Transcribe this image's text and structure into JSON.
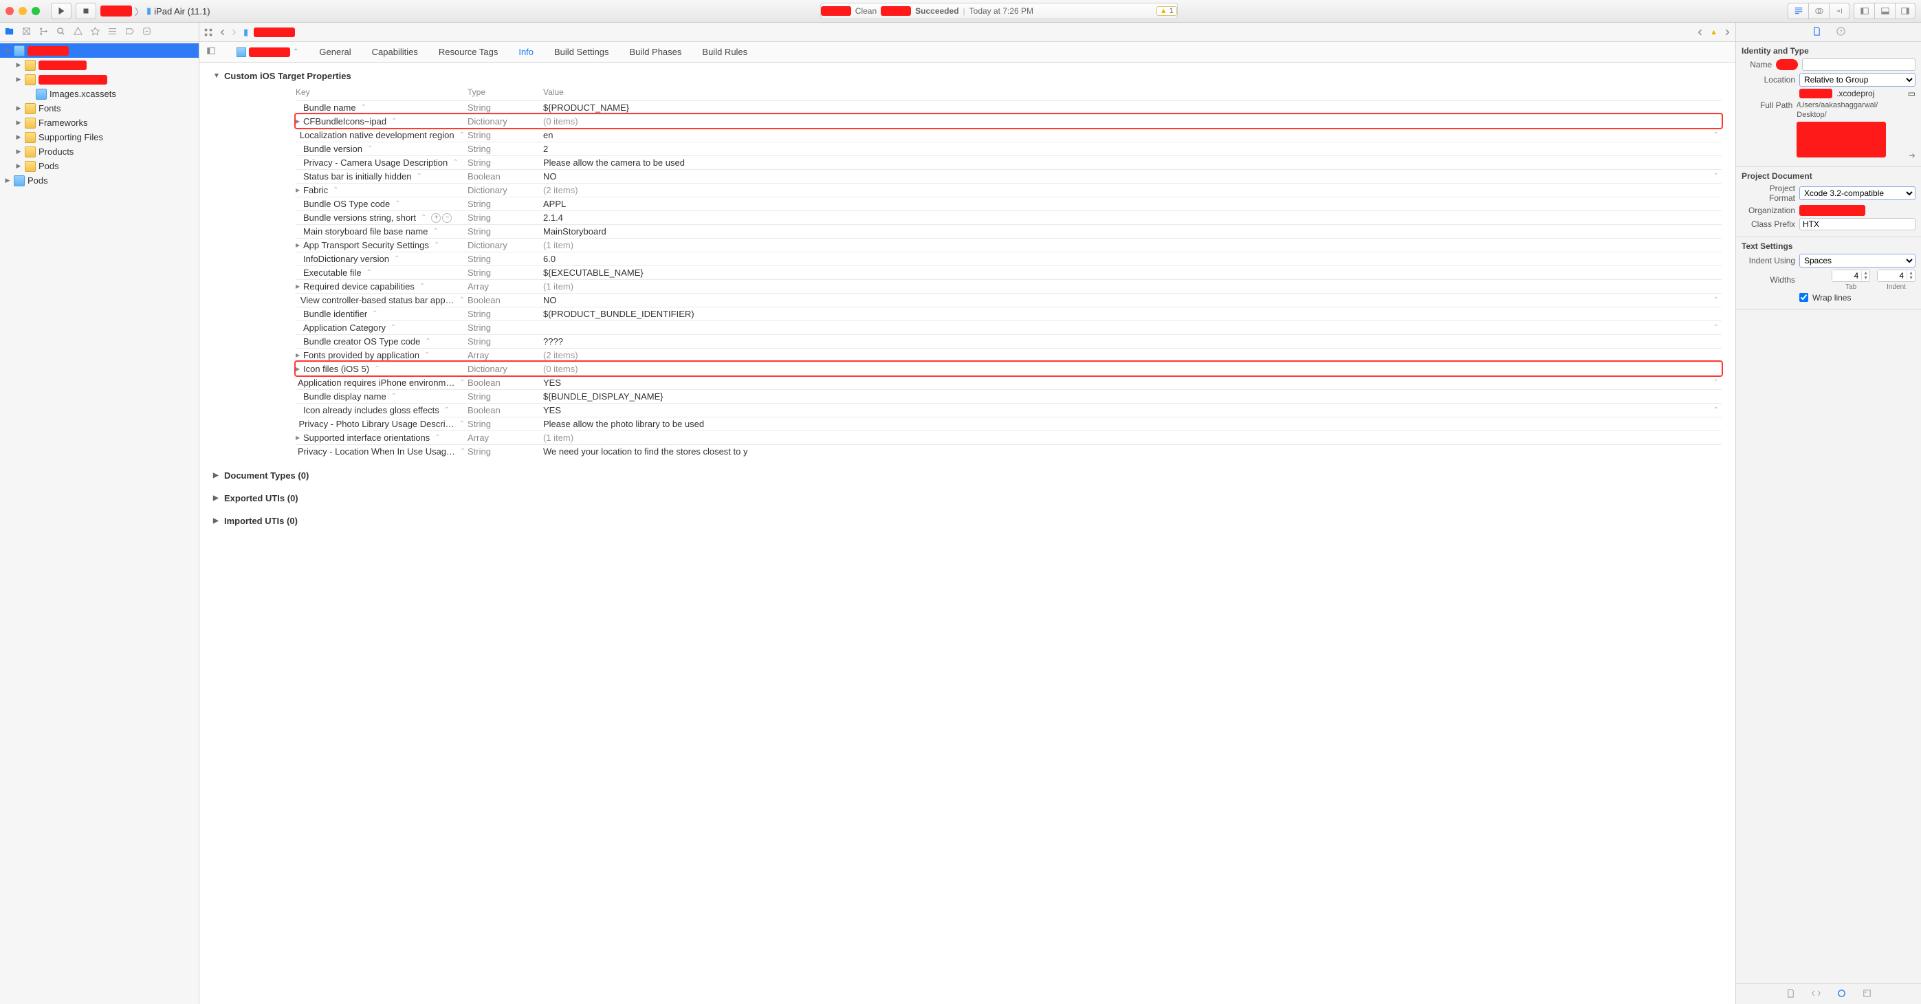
{
  "toolbar": {
    "scheme_target": "iPad Air (11.1)",
    "status_action": "Clean",
    "status_result": "Succeeded",
    "status_time": "Today at 7:26 PM",
    "warning_count": "1"
  },
  "navigator": {
    "items": [
      {
        "label": "",
        "indent": 0,
        "disc": "▼",
        "icon": "bfile",
        "sel": true,
        "redact": 60
      },
      {
        "label": "",
        "indent": 1,
        "disc": "▶",
        "icon": "yfolder",
        "redact": 70
      },
      {
        "label": "",
        "indent": 1,
        "disc": "▶",
        "icon": "yfolder",
        "redact": 100
      },
      {
        "label": "Images.xcassets",
        "indent": 2,
        "disc": "",
        "icon": "bfile"
      },
      {
        "label": "Fonts",
        "indent": 1,
        "disc": "▶",
        "icon": "yfolder"
      },
      {
        "label": "Frameworks",
        "indent": 1,
        "disc": "▶",
        "icon": "yfolder"
      },
      {
        "label": "Supporting Files",
        "indent": 1,
        "disc": "▶",
        "icon": "yfolder"
      },
      {
        "label": "Products",
        "indent": 1,
        "disc": "▶",
        "icon": "yfolder"
      },
      {
        "label": "Pods",
        "indent": 1,
        "disc": "▶",
        "icon": "yfolder"
      },
      {
        "label": "Pods",
        "indent": 0,
        "disc": "▶",
        "icon": "bfile"
      }
    ]
  },
  "tabs": {
    "general": "General",
    "capabilities": "Capabilities",
    "resource": "Resource Tags",
    "info": "Info",
    "build_settings": "Build Settings",
    "build_phases": "Build Phases",
    "build_rules": "Build Rules"
  },
  "plist": {
    "section_title": "Custom iOS Target Properties",
    "headers": {
      "key": "Key",
      "type": "Type",
      "value": "Value"
    },
    "rows": [
      {
        "k": "Bundle name",
        "t": "String",
        "v": "${PRODUCT_NAME}"
      },
      {
        "k": "CFBundleIcons~ipad",
        "t": "Dictionary",
        "v": "(0 items)",
        "disc": "▶",
        "gray": true,
        "hl": true
      },
      {
        "k": "Localization native development region",
        "t": "String",
        "v": "en",
        "step": true
      },
      {
        "k": "Bundle version",
        "t": "String",
        "v": "2"
      },
      {
        "k": "Privacy - Camera Usage Description",
        "t": "String",
        "v": "Please allow the camera to be used"
      },
      {
        "k": "Status bar is initially hidden",
        "t": "Boolean",
        "v": "NO",
        "step": true
      },
      {
        "k": "Fabric",
        "t": "Dictionary",
        "v": "(2 items)",
        "disc": "▶",
        "gray": true
      },
      {
        "k": "Bundle OS Type code",
        "t": "String",
        "v": "APPL"
      },
      {
        "k": "Bundle versions string, short",
        "t": "String",
        "v": "2.1.4",
        "addrm": true
      },
      {
        "k": "Main storyboard file base name",
        "t": "String",
        "v": "MainStoryboard"
      },
      {
        "k": "App Transport Security Settings",
        "t": "Dictionary",
        "v": "(1 item)",
        "disc": "▶",
        "gray": true
      },
      {
        "k": "InfoDictionary version",
        "t": "String",
        "v": "6.0"
      },
      {
        "k": "Executable file",
        "t": "String",
        "v": "${EXECUTABLE_NAME}"
      },
      {
        "k": "Required device capabilities",
        "t": "Array",
        "v": "(1 item)",
        "disc": "▶",
        "gray": true
      },
      {
        "k": "View controller-based status bar app…",
        "t": "Boolean",
        "v": "NO",
        "step": true
      },
      {
        "k": "Bundle identifier",
        "t": "String",
        "v": "$(PRODUCT_BUNDLE_IDENTIFIER)"
      },
      {
        "k": "Application Category",
        "t": "String",
        "v": "",
        "step": true
      },
      {
        "k": "Bundle creator OS Type code",
        "t": "String",
        "v": "????"
      },
      {
        "k": "Fonts provided by application",
        "t": "Array",
        "v": "(2 items)",
        "disc": "▶",
        "gray": true
      },
      {
        "k": "Icon files (iOS 5)",
        "t": "Dictionary",
        "v": "(0 items)",
        "disc": "▶",
        "gray": true,
        "hl": true
      },
      {
        "k": "Application requires iPhone environm…",
        "t": "Boolean",
        "v": "YES",
        "step": true
      },
      {
        "k": "Bundle display name",
        "t": "String",
        "v": "${BUNDLE_DISPLAY_NAME}"
      },
      {
        "k": "Icon already includes gloss effects",
        "t": "Boolean",
        "v": "YES",
        "step": true
      },
      {
        "k": "Privacy - Photo Library Usage Descri…",
        "t": "String",
        "v": "Please allow the photo library to be used"
      },
      {
        "k": "Supported interface orientations",
        "t": "Array",
        "v": "(1 item)",
        "disc": "▶",
        "gray": true
      },
      {
        "k": "Privacy - Location When In Use Usag…",
        "t": "String",
        "v": "We need your location to find the stores closest to y"
      }
    ],
    "doc_types": "Document Types (0)",
    "exported": "Exported UTIs (0)",
    "imported": "Imported UTIs (0)"
  },
  "inspector": {
    "identity_title": "Identity and Type",
    "name_label": "Name",
    "location_label": "Location",
    "location_value": "Relative to Group",
    "file_suffix": ".xcodeproj",
    "fullpath_label": "Full Path",
    "fullpath_value": "/Users/aakashaggarwal/\nDesktop/",
    "project_doc_title": "Project Document",
    "project_format_label": "Project Format",
    "project_format_value": "Xcode 3.2-compatible",
    "organization_label": "Organization",
    "class_prefix_label": "Class Prefix",
    "class_prefix_value": "HTX",
    "text_settings_title": "Text Settings",
    "indent_using_label": "Indent Using",
    "indent_using_value": "Spaces",
    "widths_label": "Widths",
    "tab_label": "Tab",
    "tab_value": "4",
    "indent_label": "Indent",
    "indent_value": "4",
    "wrap_label": "Wrap lines"
  }
}
